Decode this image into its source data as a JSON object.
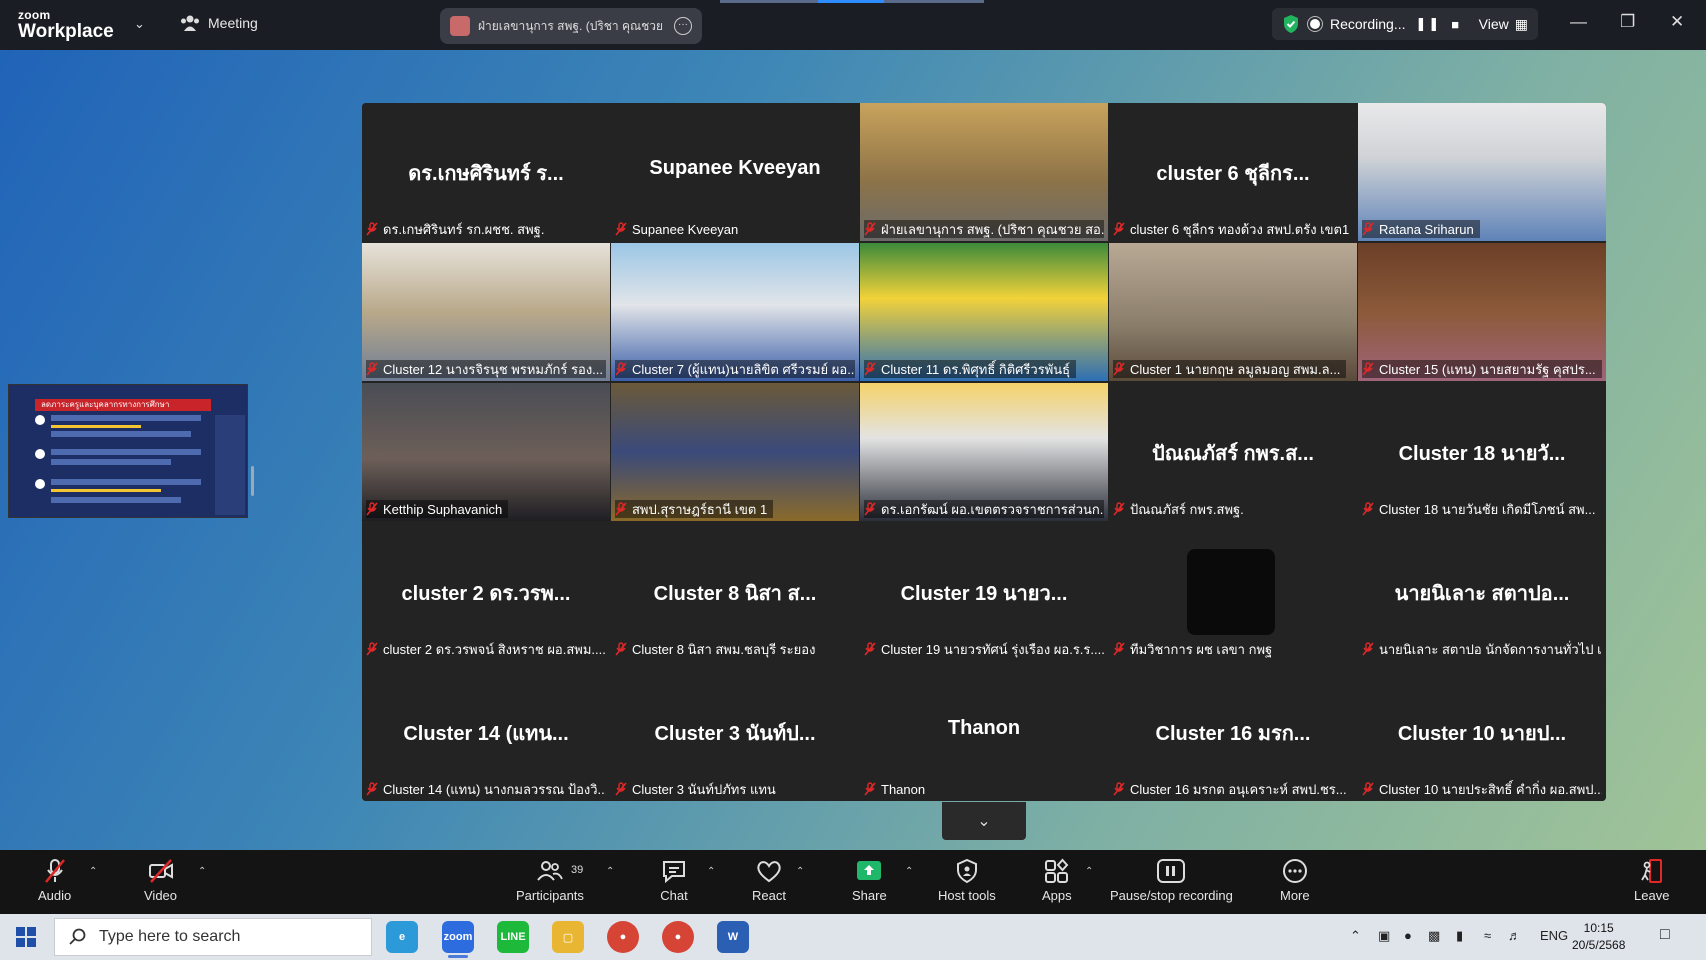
{
  "titlebar": {
    "logo_top": "zoom",
    "logo_bottom": "Workplace",
    "meeting_label": "Meeting",
    "active_speaker": "ฝ่ายเลขานุการ สพฐ. (ปริชา คุณชวย สอ.)",
    "recording_label": "Recording...",
    "view_label": "View"
  },
  "gallery": {
    "tiles": [
      {
        "big": "ดร.เกษศิรินทร์ ร...",
        "label": "ดร.เกษศิรินทร์ รก.ผชช. สพฐ."
      },
      {
        "big": "Supanee Kveeyan",
        "label": "Supanee Kveeyan"
      },
      {
        "big": "",
        "label": "ฝ่ายเลขานุการ สพฐ. (ปริชา คุณชวย สอ.)"
      },
      {
        "big": "cluster 6 ชุลีกร...",
        "label": "cluster 6 ชุลีกร ทองด้วง สพป.ตรัง เขต1"
      },
      {
        "big": "",
        "label": "Ratana Sriharun"
      },
      {
        "big": "",
        "label": "Cluster 12 นางรจิรนุช พรหมภักร์ รอง..."
      },
      {
        "big": "",
        "label": "Cluster 7 (ผู้แทน)นายลิขิต ศรีวรมย์ ผอ..."
      },
      {
        "big": "",
        "label": "Cluster 11 ดร.พิศุทธิ์ กิติศรีวรพันธุ์"
      },
      {
        "big": "",
        "label": "Cluster 1 นายกฤษ ลมูลมอญ สพม.ล..."
      },
      {
        "big": "",
        "label": "Cluster 15 (แทน) นายสยามรัฐ คุสปร..."
      },
      {
        "big": "",
        "label": "Ketthip Suphavanich"
      },
      {
        "big": "",
        "label": "สพป.สุราษฎร์ธานี เขต 1"
      },
      {
        "big": "",
        "label": "ดร.เอกรัฒน์ ผอ.เขตตรวจราชการส่วนก..."
      },
      {
        "big": "ปัณณภัสร์ กพร.ส...",
        "label": "ปัณณภัสร์ กพร.สพฐ."
      },
      {
        "big": "Cluster 18 นายวั...",
        "label": "Cluster 18 นายวันชัย เกิดมีโภชน์ สพ..."
      },
      {
        "big": "cluster 2 ดร.วรพ...",
        "label": "cluster 2 ดร.วรพจน์ สิงหราช ผอ.สพม...."
      },
      {
        "big": "Cluster 8 นิสา ส...",
        "label": "Cluster 8 นิสา สพม.ชลบุรี ระยอง"
      },
      {
        "big": "Cluster 19 นายว...",
        "label": "Cluster 19 นายวรทัศน์ รุ่งเรือง ผอ.ร.ร...."
      },
      {
        "big": "",
        "label": "ทีมวิชาการ ผช เลขา กพฐ"
      },
      {
        "big": "นายนิเลาะ สตาปอ...",
        "label": "นายนิเลาะ สตาปอ นักจัดการงานทั่วไป เข..."
      },
      {
        "big": "Cluster 14 (แทน...",
        "label": "Cluster 14 (แทน) นางกมลวรรณ ป้องวิ..."
      },
      {
        "big": "Cluster 3 นันท์ป...",
        "label": "Cluster 3 นันท์ปภัทร แทน"
      },
      {
        "big": "Thanon",
        "label": "Thanon"
      },
      {
        "big": "Cluster 16 มรก...",
        "label": "Cluster 16 มรกต อนุเคราะห์ สพป.ชร..."
      },
      {
        "big": "Cluster 10 นายป...",
        "label": "Cluster 10 นายประสิทธิ์ คำกิ่ง ผอ.สพป..."
      }
    ]
  },
  "share_thumb": {
    "header": "ลดภาระครูและบุคลากรทางการศึกษา"
  },
  "toolbar": {
    "audio": "Audio",
    "video": "Video",
    "participants": "Participants",
    "participants_count": "39",
    "chat": "Chat",
    "react": "React",
    "share": "Share",
    "host_tools": "Host tools",
    "apps": "Apps",
    "pause_stop": "Pause/stop recording",
    "more": "More",
    "leave": "Leave"
  },
  "taskbar": {
    "search_placeholder": "Type here to search",
    "lang": "ENG",
    "time": "10:15",
    "date": "20/5/2568"
  },
  "colors": {
    "accent_green": "#2fd48a",
    "share_green": "#1fb86b",
    "leave_red": "#e02828"
  }
}
